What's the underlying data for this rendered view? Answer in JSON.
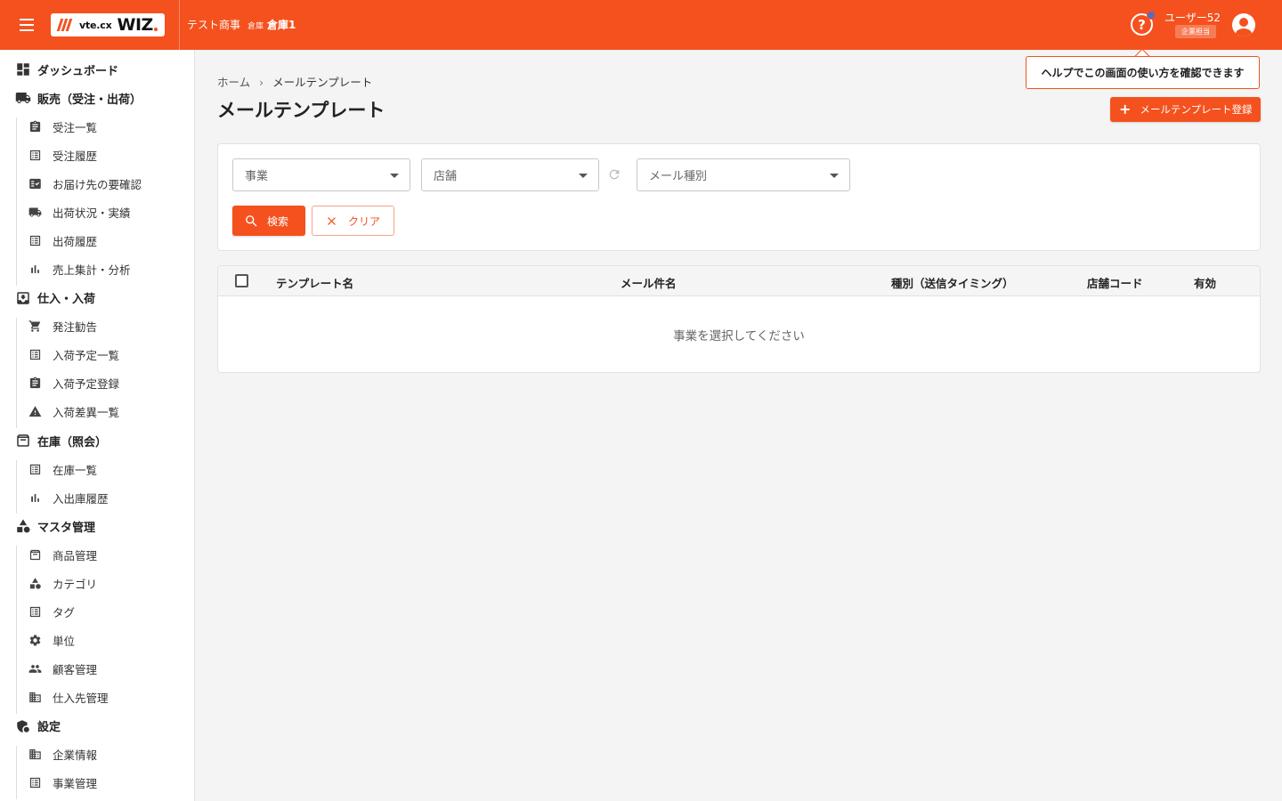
{
  "header": {
    "logo_small": "vte.cx",
    "logo_big": "WIZ",
    "company": "テスト商事",
    "warehouse_label": "倉庫",
    "warehouse_name": "倉庫1",
    "user_name": "ユーザー52",
    "user_role": "企業担当",
    "help_tooltip": "ヘルプでこの画面の使い方を確認できます"
  },
  "sidebar": {
    "sections": [
      {
        "label": "ダッシュボード",
        "icon": "dashboard-icon",
        "items": []
      },
      {
        "label": "販売（受注・出荷）",
        "icon": "truck-icon",
        "items": [
          {
            "label": "受注一覧",
            "icon": "assignment-icon"
          },
          {
            "label": "受注履歴",
            "icon": "list-icon"
          },
          {
            "label": "お届け先の要確認",
            "icon": "fact-check-icon"
          },
          {
            "label": "出荷状況・実績",
            "icon": "truck-icon"
          },
          {
            "label": "出荷履歴",
            "icon": "list-icon"
          },
          {
            "label": "売上集計・分析",
            "icon": "bar-chart-icon"
          }
        ]
      },
      {
        "label": "仕入・入荷",
        "icon": "move-to-inbox-icon",
        "items": [
          {
            "label": "発注勧告",
            "icon": "cart-icon"
          },
          {
            "label": "入荷予定一覧",
            "icon": "list-icon"
          },
          {
            "label": "入荷予定登録",
            "icon": "assignment-icon"
          },
          {
            "label": "入荷差異一覧",
            "icon": "warning-icon"
          }
        ]
      },
      {
        "label": "在庫（照会）",
        "icon": "archive-icon",
        "items": [
          {
            "label": "在庫一覧",
            "icon": "list-icon"
          },
          {
            "label": "入出庫履歴",
            "icon": "bar-chart-icon"
          }
        ]
      },
      {
        "label": "マスタ管理",
        "icon": "category-icon",
        "items": [
          {
            "label": "商品管理",
            "icon": "archive-icon"
          },
          {
            "label": "カテゴリ",
            "icon": "category-icon"
          },
          {
            "label": "タグ",
            "icon": "list-icon"
          },
          {
            "label": "単位",
            "icon": "gear-icon"
          },
          {
            "label": "顧客管理",
            "icon": "people-icon"
          },
          {
            "label": "仕入先管理",
            "icon": "building-icon"
          }
        ]
      },
      {
        "label": "設定",
        "icon": "admin-settings-icon",
        "items": [
          {
            "label": "企業情報",
            "icon": "building-icon"
          },
          {
            "label": "事業管理",
            "icon": "list-icon"
          }
        ]
      }
    ]
  },
  "breadcrumb": {
    "home": "ホーム",
    "separator": "›",
    "current": "メールテンプレート"
  },
  "page_title": "メールテンプレート",
  "register_button": "メールテンプレート登録",
  "filters": {
    "business_placeholder": "事業",
    "store_placeholder": "店舗",
    "mail_type_placeholder": "メール種別",
    "search_label": "検索",
    "clear_label": "クリア"
  },
  "table": {
    "columns": [
      "テンプレート名",
      "メール件名",
      "種別（送信タイミング）",
      "店舗コード",
      "有効"
    ],
    "empty_message": "事業を選択してください"
  },
  "colors": {
    "accent": "#f4511e"
  }
}
